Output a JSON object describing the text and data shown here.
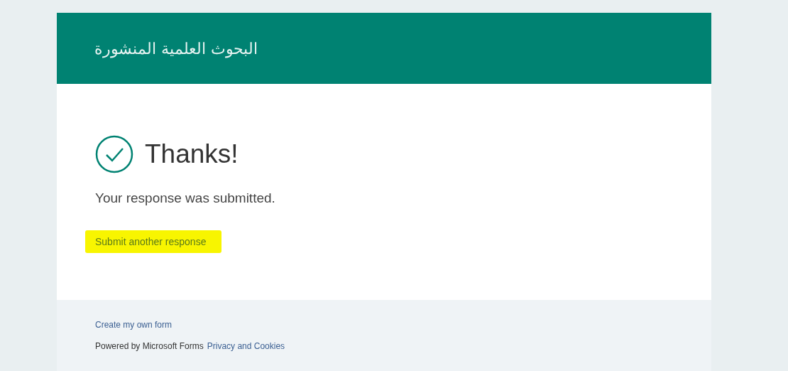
{
  "form": {
    "title": "البحوث العلمية المنشورة"
  },
  "confirmation": {
    "heading": "Thanks!",
    "message": "Your response was submitted.",
    "link": {
      "label": "Submit another response",
      "highlighted": true
    }
  },
  "footer": {
    "create_link": "Create my own form",
    "powered_by": "Powered by Microsoft Forms",
    "privacy_link": "Privacy and Cookies"
  }
}
